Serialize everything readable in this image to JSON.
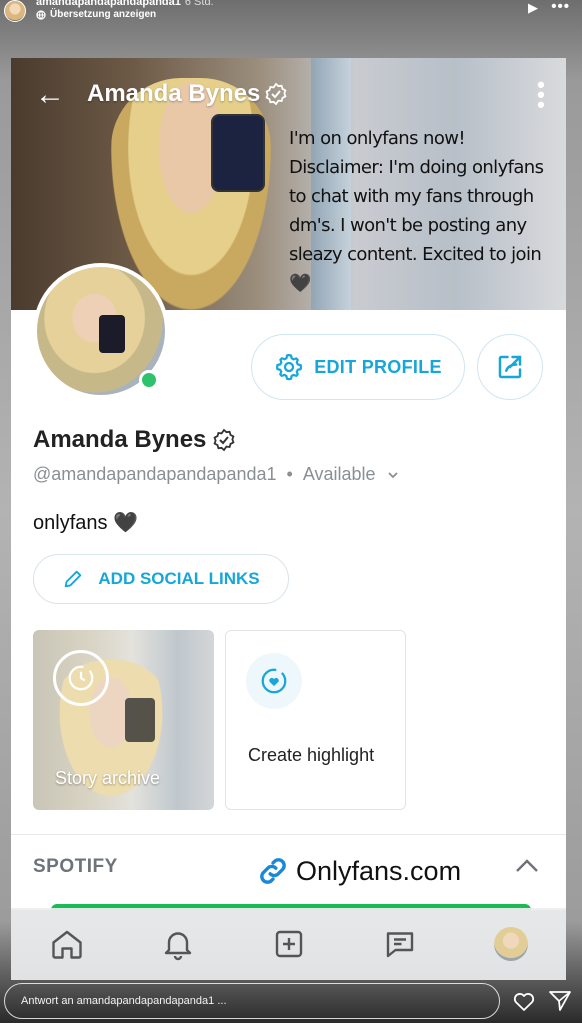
{
  "story": {
    "username": "amandapandapandapanda1",
    "time": "6 Std.",
    "translate_label": "Übersetzung anzeigen"
  },
  "profile": {
    "header_name": "Amanda Bynes",
    "banner_text": "I'm on onlyfans now! Disclaimer: I'm doing onlyfans to chat with my fans through dm's. I won't be posting any sleazy content. Excited to join 🖤",
    "edit_profile_label": "EDIT PROFILE",
    "name": "Amanda Bynes",
    "handle": "@amandapandapandapanda1",
    "separator": "•",
    "status": "Available",
    "bio": "onlyfans 🖤",
    "add_social_links_label": "ADD SOCIAL LINKS",
    "story_archive_label": "Story archive",
    "create_highlight_label": "Create highlight",
    "spotify_label": "SPOTIFY",
    "online": true
  },
  "overlay": {
    "link_text": "Onlyfans.com"
  },
  "reply": {
    "placeholder": "Antwort an amandapandapandapanda1 ..."
  },
  "colors": {
    "accent": "#16a7d8",
    "online": "#2dc26b",
    "spotify_green": "#1db954"
  },
  "icons": {
    "nav": [
      "home-icon",
      "bell-icon",
      "plus-square-icon",
      "message-icon",
      "profile-avatar"
    ]
  }
}
